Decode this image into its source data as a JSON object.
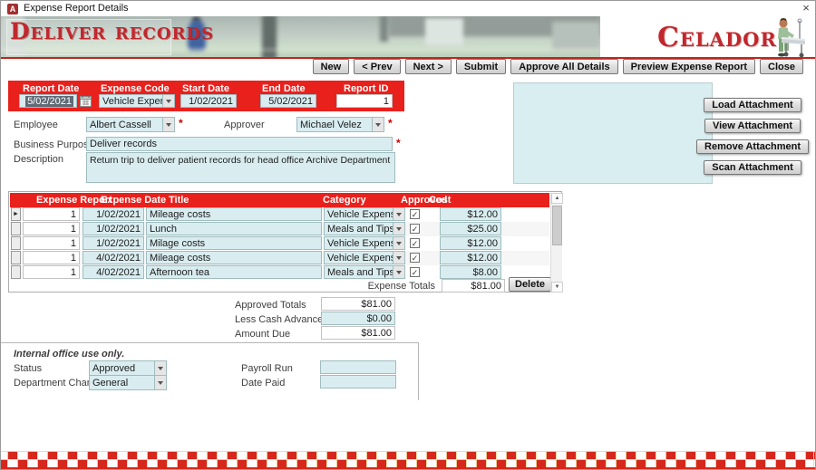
{
  "window": {
    "title": "Expense Report Details",
    "app_icon_letter": "A"
  },
  "banner": {
    "left_title": "Deliver records",
    "brand": "Celador"
  },
  "toolbar": {
    "new": "New",
    "prev": "< Prev",
    "next": "Next >",
    "submit": "Submit",
    "approve_all": "Approve All Details",
    "preview": "Preview Expense Report",
    "close": "Close"
  },
  "header_fields": {
    "report_date": {
      "label": "Report Date",
      "value": "5/02/2021"
    },
    "expense_code": {
      "label": "Expense Code",
      "value": "Vehicle Expenses"
    },
    "start_date": {
      "label": "Start Date",
      "value": "1/02/2021"
    },
    "end_date": {
      "label": "End Date",
      "value": "5/02/2021"
    },
    "report_id": {
      "label": "Report ID",
      "value": "1"
    }
  },
  "detail_fields": {
    "employee": {
      "label": "Employee",
      "value": "Albert Cassell",
      "required": "*"
    },
    "approver": {
      "label": "Approver",
      "value": "Michael Velez",
      "required": "*"
    },
    "business_purpose": {
      "label": "Business Purpose",
      "value": "Deliver records",
      "required": "*"
    },
    "description": {
      "label": "Description",
      "value": "Return trip to deliver patient records for head office Archive Department"
    }
  },
  "attachments": {
    "load": "Load Attachment",
    "view": "View Attachment",
    "remove": "Remove Attachment",
    "scan": "Scan Attachment"
  },
  "grid": {
    "columns": [
      "Expense Report",
      "Expense Date",
      "Title",
      "Category",
      "Approved",
      "Cost"
    ],
    "rows": [
      {
        "expense_report": "1",
        "expense_date": "1/02/2021",
        "title": "Mileage costs",
        "category": "Vehicle Expenses",
        "approved": true,
        "cost": "$12.00"
      },
      {
        "expense_report": "1",
        "expense_date": "1/02/2021",
        "title": "Lunch",
        "category": "Meals and Tips",
        "approved": true,
        "cost": "$25.00"
      },
      {
        "expense_report": "1",
        "expense_date": "1/02/2021",
        "title": "Milage costs",
        "category": "Vehicle Expenses",
        "approved": true,
        "cost": "$12.00"
      },
      {
        "expense_report": "1",
        "expense_date": "4/02/2021",
        "title": "Mileage costs",
        "category": "Vehicle Expenses",
        "approved": true,
        "cost": "$12.00"
      },
      {
        "expense_report": "1",
        "expense_date": "4/02/2021",
        "title": "Afternoon tea",
        "category": "Meals and Tips",
        "approved": true,
        "cost": "$8.00"
      }
    ],
    "footer": {
      "expense_totals_label": "Expense Totals",
      "expense_totals_value": "$81.00",
      "delete_label": "Delete"
    }
  },
  "totals": {
    "approved_totals": {
      "label": "Approved Totals",
      "value": "$81.00"
    },
    "less_cash_advance": {
      "label": "Less Cash Advance",
      "value": "$0.00"
    },
    "amount_due": {
      "label": "Amount Due",
      "value": "$81.00"
    }
  },
  "internal": {
    "heading": "Internal office use only.",
    "status": {
      "label": "Status",
      "value": "Approved"
    },
    "department_charged": {
      "label": "Department Charged",
      "value": "General"
    },
    "payroll_run": {
      "label": "Payroll Run",
      "value": ""
    },
    "date_paid": {
      "label": "Date Paid",
      "value": ""
    }
  },
  "icons": {
    "close": "×",
    "record_selector_arrow": "►",
    "checkbox_check": "✓",
    "scroll_up": "▲",
    "scroll_down": "▼"
  },
  "colors": {
    "accent_red": "#e8211d",
    "field_cyan": "#d9edf0",
    "checker_red": "#d5271c",
    "brand_red": "#c1272d"
  }
}
